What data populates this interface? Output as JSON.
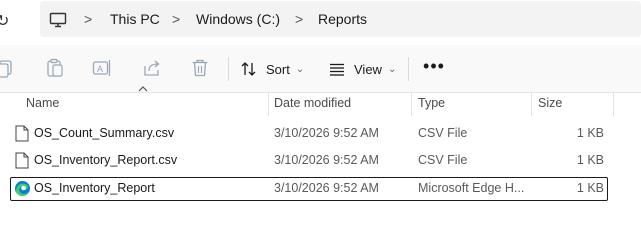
{
  "address_bar": {
    "refresh_icon": "refresh-icon",
    "pc_icon": "this-pc-icon",
    "breadcrumbs": [
      "This PC",
      "Windows (C:)",
      "Reports"
    ],
    "separator": ">"
  },
  "command_bar": {
    "icons": [
      "copy-icon",
      "paste-icon",
      "rename-icon",
      "share-icon",
      "delete-icon"
    ],
    "sort_label": "Sort",
    "view_label": "View",
    "more_label": "•••"
  },
  "columns": {
    "name": "Name",
    "date": "Date modified",
    "type": "Type",
    "size": "Size"
  },
  "files": [
    {
      "name": "OS_Count_Summary.csv",
      "date": "3/10/2026 9:52 AM",
      "type": "CSV File",
      "size": "1 KB",
      "icon": "csv-file-icon",
      "selected": false
    },
    {
      "name": "OS_Inventory_Report.csv",
      "date": "3/10/2026 9:52 AM",
      "type": "CSV File",
      "size": "1 KB",
      "icon": "csv-file-icon",
      "selected": false
    },
    {
      "name": "OS_Inventory_Report",
      "date": "3/10/2026 9:52 AM",
      "type": "Microsoft Edge H...",
      "size": "1 KB",
      "icon": "edge-html-icon",
      "selected": true
    }
  ],
  "colors": {
    "selection_border": "#1a1a1a",
    "edge_blue": "#0c7bd8",
    "edge_green": "#3ccf6e"
  }
}
